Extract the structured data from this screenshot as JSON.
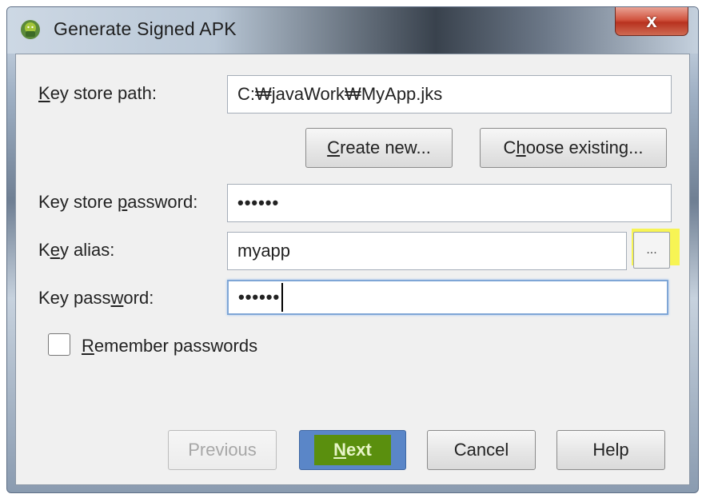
{
  "window": {
    "title": "Generate Signed APK",
    "close_label": "x",
    "icon": "android-studio-icon"
  },
  "form": {
    "key_store_path": {
      "label_pre": "",
      "label_u": "K",
      "label_post": "ey store path:",
      "value": "C:₩javaWork₩MyApp.jks"
    },
    "create_new_button": {
      "label_pre": "",
      "label_u": "C",
      "label_post": "reate new..."
    },
    "choose_existing_button": {
      "label_pre": "C",
      "label_u": "h",
      "label_post": "oose existing..."
    },
    "key_store_password": {
      "label_pre": "Key store ",
      "label_u": "p",
      "label_post": "assword:",
      "value": "••••••"
    },
    "key_alias": {
      "label_pre": "K",
      "label_u": "e",
      "label_post": "y alias:",
      "value": "myapp",
      "browse_label": "..."
    },
    "key_password": {
      "label_pre": "Key pass",
      "label_u": "w",
      "label_post": "ord:",
      "value": "••••••"
    },
    "remember_passwords": {
      "label_pre": "",
      "label_u": "R",
      "label_post": "emember passwords",
      "checked": false
    }
  },
  "footer": {
    "previous": "Previous",
    "next_u": "N",
    "next_post": "ext",
    "cancel": "Cancel",
    "help": "Help"
  },
  "colors": {
    "highlight_yellow": "#f7f447",
    "next_highlight_green": "#5a8f0e",
    "primary_button_blue": "#5a86c8"
  }
}
